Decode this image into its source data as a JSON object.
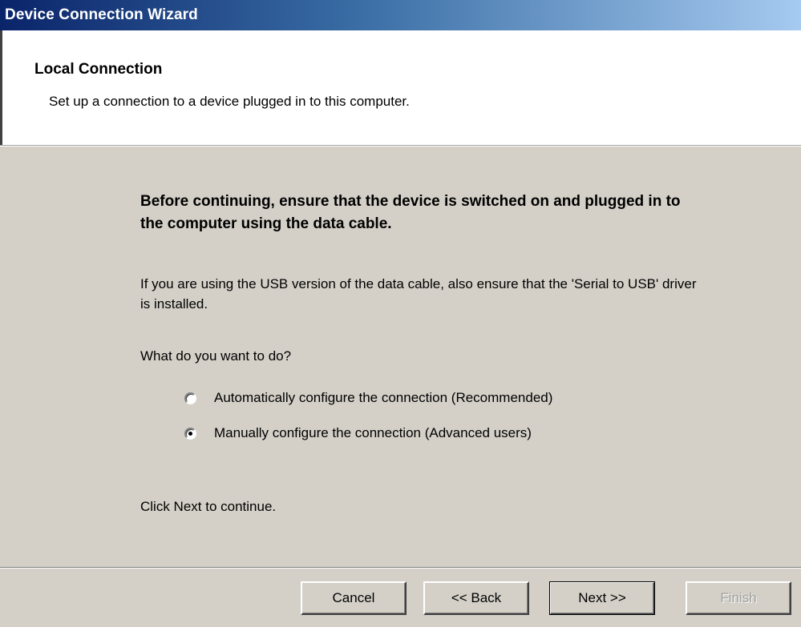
{
  "window": {
    "title": "Device Connection Wizard"
  },
  "header": {
    "title": "Local Connection",
    "subtitle": "Set up a connection to a device plugged in to this computer."
  },
  "body": {
    "warning": "Before continuing, ensure that the device is switched on and plugged in to the computer using the data cable.",
    "info": "If you are using the USB version of the data cable, also ensure that the 'Serial to USB' driver is installed.",
    "question": "What do you want to do?",
    "options": [
      {
        "label": "Automatically configure the connection (Recommended)",
        "selected": false
      },
      {
        "label": "Manually configure the connection (Advanced users)",
        "selected": true
      }
    ],
    "continue_hint": "Click Next to continue."
  },
  "buttons": {
    "cancel": "Cancel",
    "back": "<< Back",
    "next": "Next >>",
    "finish": "Finish"
  }
}
